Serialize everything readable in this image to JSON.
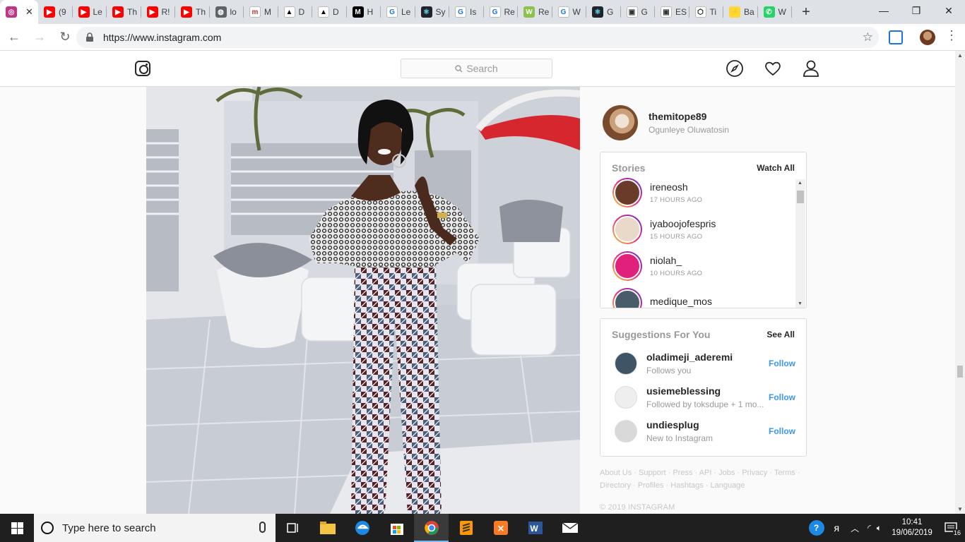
{
  "browser": {
    "tabs": [
      {
        "label": "",
        "color": "#c13584",
        "glyph": "◎",
        "active": true
      },
      {
        "label": "(9",
        "color": "#ff0000",
        "glyph": "▶"
      },
      {
        "label": "Le",
        "color": "#ff0000",
        "glyph": "▶"
      },
      {
        "label": "Th",
        "color": "#ff0000",
        "glyph": "▶"
      },
      {
        "label": "R!",
        "color": "#ff0000",
        "glyph": "▶"
      },
      {
        "label": "Th",
        "color": "#ff0000",
        "glyph": "▶"
      },
      {
        "label": "lo",
        "color": "#5f6368",
        "glyph": "◍"
      },
      {
        "label": "M",
        "color": "#ffffff",
        "glyph": "m",
        "fg": "#c0392b"
      },
      {
        "label": "D",
        "color": "#ffffff",
        "glyph": "▲",
        "fg": "#000"
      },
      {
        "label": "D",
        "color": "#ffffff",
        "glyph": "▲",
        "fg": "#000"
      },
      {
        "label": "H",
        "color": "#000000",
        "glyph": "M"
      },
      {
        "label": "Le",
        "color": "#ffffff",
        "glyph": "G",
        "fg": "#1a73e8"
      },
      {
        "label": "Sy",
        "color": "#20232a",
        "glyph": "⚛",
        "fg": "#61dafb"
      },
      {
        "label": "Is",
        "color": "#ffffff",
        "glyph": "G",
        "fg": "#1a73e8"
      },
      {
        "label": "Re",
        "color": "#ffffff",
        "glyph": "G",
        "fg": "#1a73e8"
      },
      {
        "label": "Re",
        "color": "#8bc34a",
        "glyph": "W"
      },
      {
        "label": "W",
        "color": "#ffffff",
        "glyph": "G",
        "fg": "#1a73e8"
      },
      {
        "label": "G",
        "color": "#20232a",
        "glyph": "⚛",
        "fg": "#61dafb"
      },
      {
        "label": "G",
        "color": "#ffffff",
        "glyph": "▣",
        "fg": "#333"
      },
      {
        "label": "ES",
        "color": "#ffffff",
        "glyph": "▣",
        "fg": "#333"
      },
      {
        "label": "Ti",
        "color": "#ffffff",
        "glyph": "⬡",
        "fg": "#000"
      },
      {
        "label": "Ba",
        "color": "#fdd835",
        "glyph": "⚡",
        "fg": "#333"
      },
      {
        "label": "W",
        "color": "#25d366",
        "glyph": "✆"
      }
    ],
    "url": "https://www.instagram.com"
  },
  "instagram": {
    "search_placeholder": "Search",
    "me": {
      "username": "themitope89",
      "fullname": "Ogunleye Oluwatosin"
    },
    "stories": {
      "title": "Stories",
      "action": "Watch All",
      "items": [
        {
          "user": "ireneosh",
          "time": "17 HOURS AGO",
          "color": "#6b3b2a"
        },
        {
          "user": "iyaboojofespris",
          "time": "15 HOURS AGO",
          "color": "#e8d9c8"
        },
        {
          "user": "niolah_",
          "time": "10 HOURS AGO",
          "color": "#e0207a"
        },
        {
          "user": "medique_mos",
          "time": "",
          "color": "#4a5b6a"
        }
      ]
    },
    "suggestions": {
      "title": "Suggestions For You",
      "action": "See All",
      "items": [
        {
          "user": "oladimeji_aderemi",
          "sub": "Follows you",
          "follow": "Follow",
          "color": "#3d5566"
        },
        {
          "user": "usiemeblessing",
          "sub": "Followed by toksdupe + 1 mo...",
          "follow": "Follow",
          "color": "#eeeeee"
        },
        {
          "user": "undiesplug",
          "sub": "New to Instagram",
          "follow": "Follow",
          "color": "#d9d9d9"
        }
      ]
    },
    "footer": {
      "links": [
        "About Us",
        "Support",
        "Press",
        "API",
        "Jobs",
        "Privacy",
        "Terms",
        "Directory",
        "Profiles",
        "Hashtags",
        "Language"
      ],
      "copyright": "© 2019 INSTAGRAM"
    }
  },
  "taskbar": {
    "search_placeholder": "Type here to search",
    "time": "10:41",
    "date": "19/06/2019",
    "notifications": "16"
  }
}
